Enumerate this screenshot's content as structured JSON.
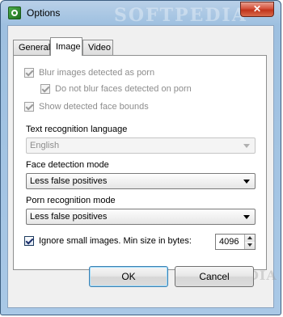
{
  "window": {
    "title": "Options",
    "watermark": "SOFTPEDIA",
    "close_glyph": "✕"
  },
  "tabs": [
    {
      "label": "General",
      "active": false
    },
    {
      "label": "Image",
      "active": true
    },
    {
      "label": "Video",
      "active": false
    }
  ],
  "image": {
    "blur_porn": {
      "label": "Blur images detected as porn",
      "checked": true,
      "enabled": false
    },
    "no_blur_faces": {
      "label": "Do not blur faces detected on porn",
      "checked": true,
      "enabled": false
    },
    "show_face_bounds": {
      "label": "Show detected face bounds",
      "checked": true,
      "enabled": false
    },
    "text_lang": {
      "label": "Text recognition language",
      "value": "English",
      "enabled": false
    },
    "face_mode": {
      "label": "Face detection mode",
      "value": "Less false positives"
    },
    "porn_mode": {
      "label": "Porn recognition mode",
      "value": "Less false positives"
    },
    "ignore_small": {
      "label": "Ignore small images. Min size in bytes:",
      "checked": true,
      "min_size": "4096"
    },
    "watermark": "SOFTPEDIA"
  },
  "buttons": {
    "ok": "OK",
    "cancel": "Cancel"
  }
}
